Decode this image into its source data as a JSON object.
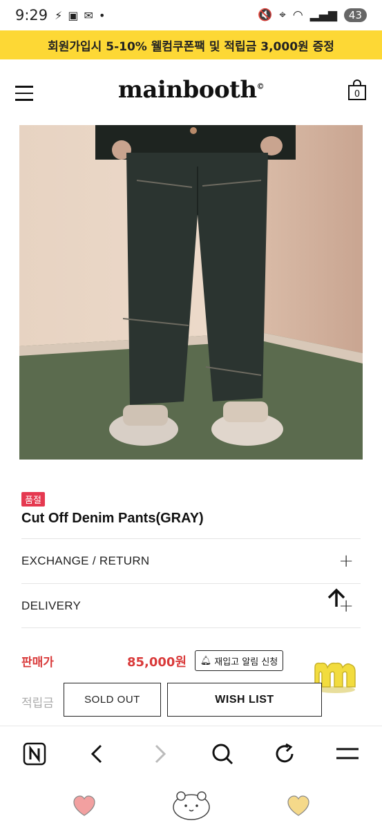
{
  "status_bar": {
    "time": "9:29",
    "battery": "43"
  },
  "promo_banner": "회원가입시 5-10% 웰컴쿠폰팩 및 적립금 3,000원 증정",
  "header": {
    "logo": "mainbooth",
    "logo_mark": "©",
    "cart_count": "0"
  },
  "product": {
    "badge": "품절",
    "title": "Cut Off Denim Pants(GRAY)"
  },
  "info_rows": [
    {
      "label": "EXCHANGE / RETURN"
    },
    {
      "label": "DELIVERY"
    }
  ],
  "pricing": {
    "price_label": "판매가",
    "price_value": "85,000원",
    "restock_label": "재입고 알림 신청",
    "points_label": "적립금"
  },
  "actions": {
    "soldout_label": "SOLD OUT",
    "wishlist_label": "WISH LIST"
  },
  "colors": {
    "promo_bg": "#fdd835",
    "price_red": "#d93a3a",
    "badge_red": "#e53950"
  }
}
